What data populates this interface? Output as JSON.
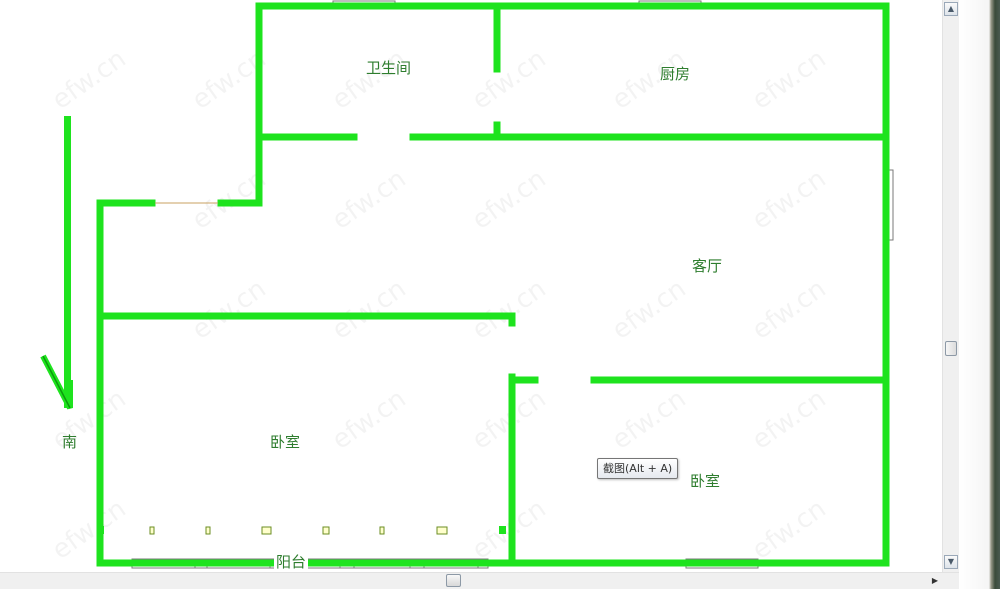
{
  "rooms": {
    "bathroom": "卫生间",
    "kitchen": "厨房",
    "living_room": "客厅",
    "bedroom_left": "卧室",
    "bedroom_right": "卧室",
    "balcony": "阳台"
  },
  "compass": {
    "label": "南"
  },
  "tooltip": {
    "text": "截图(Alt + A)"
  },
  "watermark": {
    "text": "efw.cn"
  },
  "colors": {
    "wall": "#1ee31e",
    "wall_edge": "#0d8a0d",
    "label": "#2e7d2e"
  }
}
